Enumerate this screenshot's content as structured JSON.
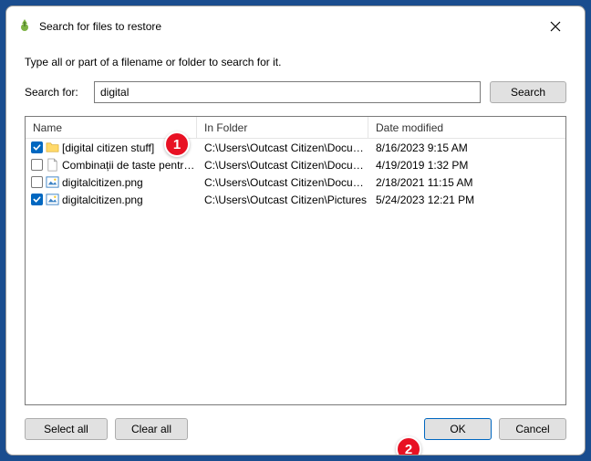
{
  "window": {
    "title": "Search for files to restore"
  },
  "instruction": "Type all or part of a filename or folder to search for it.",
  "search": {
    "label": "Search for:",
    "value": "digital",
    "button": "Search"
  },
  "columns": {
    "name": "Name",
    "folder": "In Folder",
    "date": "Date modified"
  },
  "results": [
    {
      "checked": true,
      "icon": "folder",
      "name": "[digital citizen stuff]",
      "folder": "C:\\Users\\Outcast Citizen\\Docum...",
      "date": "8/16/2023 9:15 AM"
    },
    {
      "checked": false,
      "icon": "file",
      "name": "Combinații de taste pentru ...",
      "folder": "C:\\Users\\Outcast Citizen\\Docum...",
      "date": "4/19/2019 1:32 PM"
    },
    {
      "checked": false,
      "icon": "image",
      "name": "digitalcitizen.png",
      "folder": "C:\\Users\\Outcast Citizen\\Docum...",
      "date": "2/18/2021 11:15 AM"
    },
    {
      "checked": true,
      "icon": "image",
      "name": "digitalcitizen.png",
      "folder": "C:\\Users\\Outcast Citizen\\Pictures",
      "date": "5/24/2023 12:21 PM"
    }
  ],
  "buttons": {
    "select_all": "Select all",
    "clear_all": "Clear all",
    "ok": "OK",
    "cancel": "Cancel"
  },
  "annotations": {
    "badge1": "1",
    "badge2": "2"
  }
}
